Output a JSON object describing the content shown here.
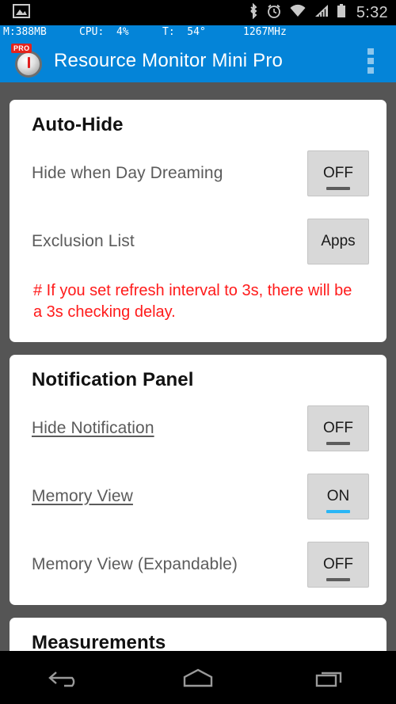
{
  "status_bar": {
    "icons": [
      "image-icon",
      "bluetooth-icon",
      "alarm-clock-icon",
      "wifi-icon",
      "signal-icon",
      "battery-icon"
    ],
    "clock": "5:32"
  },
  "monitor_bar": {
    "memory": "M:388MB",
    "cpu": "CPU:  4%",
    "temperature": "T:  54°",
    "frequency": "1267MHz",
    "background_color": "#0484d8"
  },
  "app_bar": {
    "title": "Resource Monitor Mini Pro",
    "badge": "PRO",
    "icon": "gauge-icon",
    "overflow_icon": "overflow-menu-icon",
    "background_color": "#0484d8"
  },
  "cards": [
    {
      "title": "Auto-Hide",
      "rows": [
        {
          "label": "Hide when Day Dreaming",
          "underline": false,
          "button": "OFF",
          "indicator": "off"
        },
        {
          "label": "Exclusion List",
          "underline": false,
          "button": "Apps",
          "indicator": "none"
        }
      ],
      "note": "# If you set refresh interval to 3s, there will be a 3s checking delay.",
      "note_color": "#ff1a1a"
    },
    {
      "title": "Notification Panel",
      "rows": [
        {
          "label": "Hide Notification",
          "underline": true,
          "button": "OFF",
          "indicator": "off"
        },
        {
          "label": "Memory View",
          "underline": true,
          "button": "ON",
          "indicator": "on"
        },
        {
          "label": "Memory View (Expandable)",
          "underline": false,
          "button": "OFF",
          "indicator": "off"
        }
      ]
    },
    {
      "title": "Measurements",
      "rows": []
    }
  ],
  "nav_bar": {
    "back": "back-icon",
    "home": "home-icon",
    "recents": "recents-icon"
  }
}
